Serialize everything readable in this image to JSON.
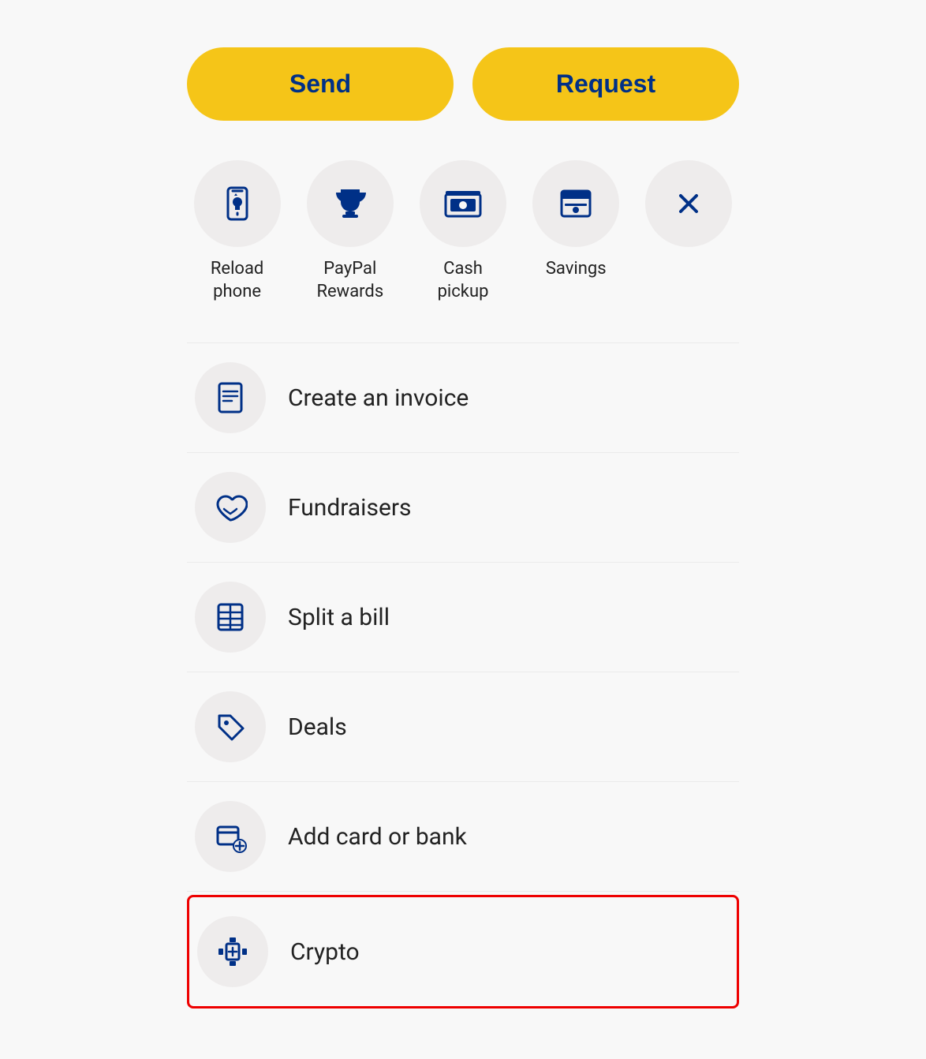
{
  "buttons": {
    "send": "Send",
    "request": "Request"
  },
  "quickActions": [
    {
      "id": "reload-phone",
      "label": "Reload\nphone",
      "icon": "reload-phone-icon"
    },
    {
      "id": "paypal-rewards",
      "label": "PayPal\nRewards",
      "icon": "trophy-icon"
    },
    {
      "id": "cash-pickup",
      "label": "Cash\npickup",
      "icon": "cash-pickup-icon"
    },
    {
      "id": "savings",
      "label": "Savings",
      "icon": "savings-icon"
    },
    {
      "id": "close",
      "label": "",
      "icon": "close-icon"
    }
  ],
  "listItems": [
    {
      "id": "create-invoice",
      "label": "Create an invoice",
      "icon": "invoice-icon",
      "highlighted": false
    },
    {
      "id": "fundraisers",
      "label": "Fundraisers",
      "icon": "fundraisers-icon",
      "highlighted": false
    },
    {
      "id": "split-bill",
      "label": "Split a bill",
      "icon": "split-bill-icon",
      "highlighted": false
    },
    {
      "id": "deals",
      "label": "Deals",
      "icon": "deals-icon",
      "highlighted": false
    },
    {
      "id": "add-card-bank",
      "label": "Add card or bank",
      "icon": "add-card-icon",
      "highlighted": false
    },
    {
      "id": "crypto",
      "label": "Crypto",
      "icon": "crypto-icon",
      "highlighted": true
    }
  ]
}
